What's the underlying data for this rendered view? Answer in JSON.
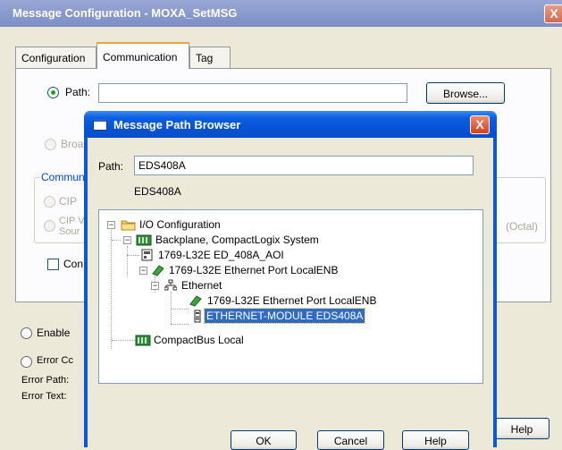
{
  "outer": {
    "title": "Message Configuration - MOXA_SetMSG",
    "close_label": "X",
    "tabs": [
      {
        "label": "Configuration"
      },
      {
        "label": "Communication"
      },
      {
        "label": "Tag"
      }
    ],
    "path_label": "Path:",
    "path_value": "",
    "browse_label": "Browse...",
    "broadcast_label": "Broa",
    "comm_group_label": "Commun",
    "cip_label": "CIP",
    "cip2_label_line1": "CIP V",
    "cip2_label_line2": "Sour",
    "octal_label": "(Octal)",
    "connected_label": "Con",
    "enable_label": "Enable",
    "error_code_label": "Error Cc",
    "error_path_label": "Error Path:",
    "error_text_label": "Error Text:",
    "help_label": "Help"
  },
  "dialog": {
    "title": "Message Path Browser",
    "close_label": "X",
    "path_label": "Path:",
    "path_value": "EDS408A",
    "path_echo": "EDS408A",
    "tree": [
      {
        "label": "I/O Configuration",
        "icon": "folder-icon"
      },
      {
        "label": "Backplane, CompactLogix System",
        "icon": "backplane-icon"
      },
      {
        "label": "1769-L32E ED_408A_AOI",
        "icon": "controller-icon"
      },
      {
        "label": "1769-L32E Ethernet Port LocalENB",
        "icon": "ethernet-port-icon"
      },
      {
        "label": "Ethernet",
        "icon": "network-icon"
      },
      {
        "label": "1769-L32E Ethernet Port LocalENB",
        "icon": "ethernet-port-icon"
      },
      {
        "label": "ETHERNET-MODULE EDS408A",
        "icon": "module-icon"
      },
      {
        "label": "CompactBus Local",
        "icon": "bus-icon"
      }
    ],
    "ok_label": "OK",
    "cancel_label": "Cancel",
    "help_label": "Help"
  },
  "colors": {
    "dialog_title_blue": "#0653d8",
    "outer_title_grey_blue": "#8a9bce",
    "selection_blue": "#316ac5",
    "window_face": "#ece9d8"
  }
}
